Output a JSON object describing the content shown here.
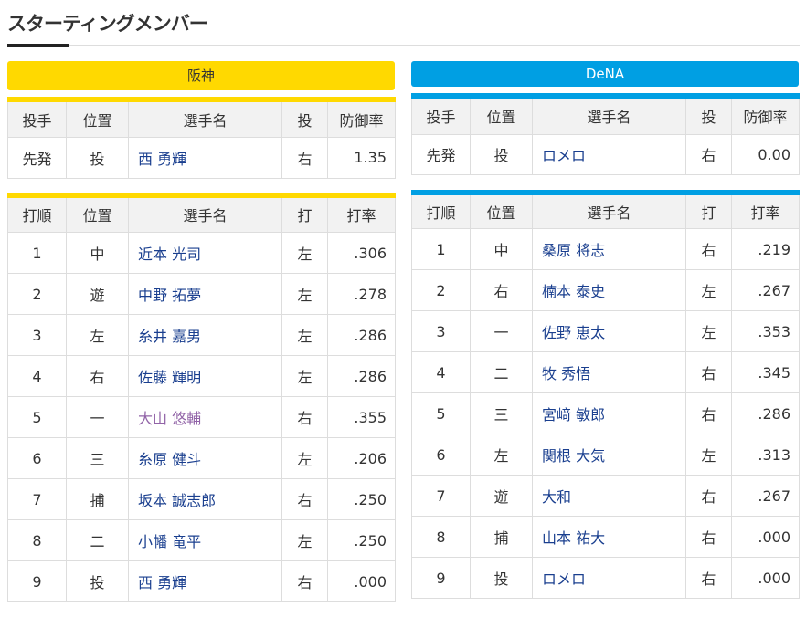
{
  "page_title": "スターティングメンバー",
  "pitcher_headers": [
    "投手",
    "位置",
    "選手名",
    "投",
    "防御率"
  ],
  "batter_headers": [
    "打順",
    "位置",
    "選手名",
    "打",
    "打率"
  ],
  "teams": [
    {
      "name": "阪神",
      "color": "#ffd900",
      "pitcher": {
        "role": "先発",
        "pos": "投",
        "name": "西 勇輝",
        "hand": "右",
        "era": "1.35"
      },
      "batters": [
        {
          "order": "1",
          "pos": "中",
          "name": "近本 光司",
          "hand": "左",
          "avg": ".306"
        },
        {
          "order": "2",
          "pos": "遊",
          "name": "中野 拓夢",
          "hand": "左",
          "avg": ".278"
        },
        {
          "order": "3",
          "pos": "左",
          "name": "糸井 嘉男",
          "hand": "左",
          "avg": ".286"
        },
        {
          "order": "4",
          "pos": "右",
          "name": "佐藤 輝明",
          "hand": "左",
          "avg": ".286"
        },
        {
          "order": "5",
          "pos": "一",
          "name": "大山 悠輔",
          "hand": "右",
          "avg": ".355"
        },
        {
          "order": "6",
          "pos": "三",
          "name": "糸原 健斗",
          "hand": "左",
          "avg": ".206"
        },
        {
          "order": "7",
          "pos": "捕",
          "name": "坂本 誠志郎",
          "hand": "右",
          "avg": ".250"
        },
        {
          "order": "8",
          "pos": "二",
          "name": "小幡 竜平",
          "hand": "左",
          "avg": ".250"
        },
        {
          "order": "9",
          "pos": "投",
          "name": "西 勇輝",
          "hand": "右",
          "avg": ".000"
        }
      ]
    },
    {
      "name": "DeNA",
      "color": "#009fe3",
      "pitcher": {
        "role": "先発",
        "pos": "投",
        "name": "ロメロ",
        "hand": "右",
        "era": "0.00"
      },
      "batters": [
        {
          "order": "1",
          "pos": "中",
          "name": "桑原 将志",
          "hand": "右",
          "avg": ".219"
        },
        {
          "order": "2",
          "pos": "右",
          "name": "楠本 泰史",
          "hand": "左",
          "avg": ".267"
        },
        {
          "order": "3",
          "pos": "一",
          "name": "佐野 恵太",
          "hand": "左",
          "avg": ".353"
        },
        {
          "order": "4",
          "pos": "二",
          "name": "牧 秀悟",
          "hand": "右",
          "avg": ".345"
        },
        {
          "order": "5",
          "pos": "三",
          "name": "宮﨑 敏郎",
          "hand": "右",
          "avg": ".286"
        },
        {
          "order": "6",
          "pos": "左",
          "name": "関根 大気",
          "hand": "左",
          "avg": ".313"
        },
        {
          "order": "7",
          "pos": "遊",
          "name": "大和",
          "hand": "右",
          "avg": ".267"
        },
        {
          "order": "8",
          "pos": "捕",
          "name": "山本 祐大",
          "hand": "右",
          "avg": ".000"
        },
        {
          "order": "9",
          "pos": "投",
          "name": "ロメロ",
          "hand": "右",
          "avg": ".000"
        }
      ]
    }
  ]
}
